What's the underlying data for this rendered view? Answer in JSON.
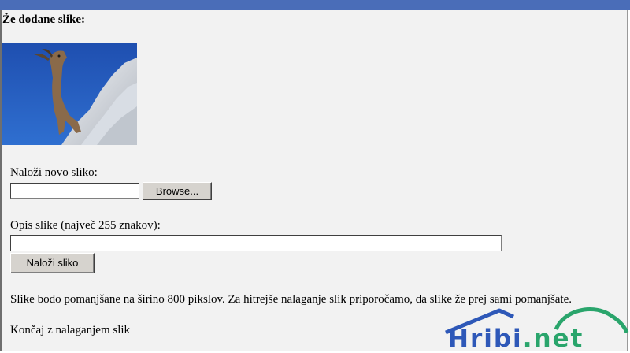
{
  "heading": "Že dodane slike:",
  "upload": {
    "label": "Naloži novo sliko:",
    "file_value": "",
    "browse_label": "Browse..."
  },
  "description": {
    "label": "Opis slike (največ 255 znakov):",
    "value": ""
  },
  "upload_button_label": "Naloži sliko",
  "note": "Slike bodo pomanjšane na širino 800 pikslov. Za hitrejše nalaganje slik priporočamo, da slike že prej sami pomanjšate.",
  "finish_link": "Končaj z nalaganjem slik",
  "logo": {
    "text_main": "Hribi",
    "text_dot_net": ".net",
    "colors": {
      "blue": "#2e58b8",
      "green": "#2aa56c"
    }
  },
  "colors": {
    "top_bar": "#4a6db8",
    "panel_bg": "#f2f2f2"
  }
}
